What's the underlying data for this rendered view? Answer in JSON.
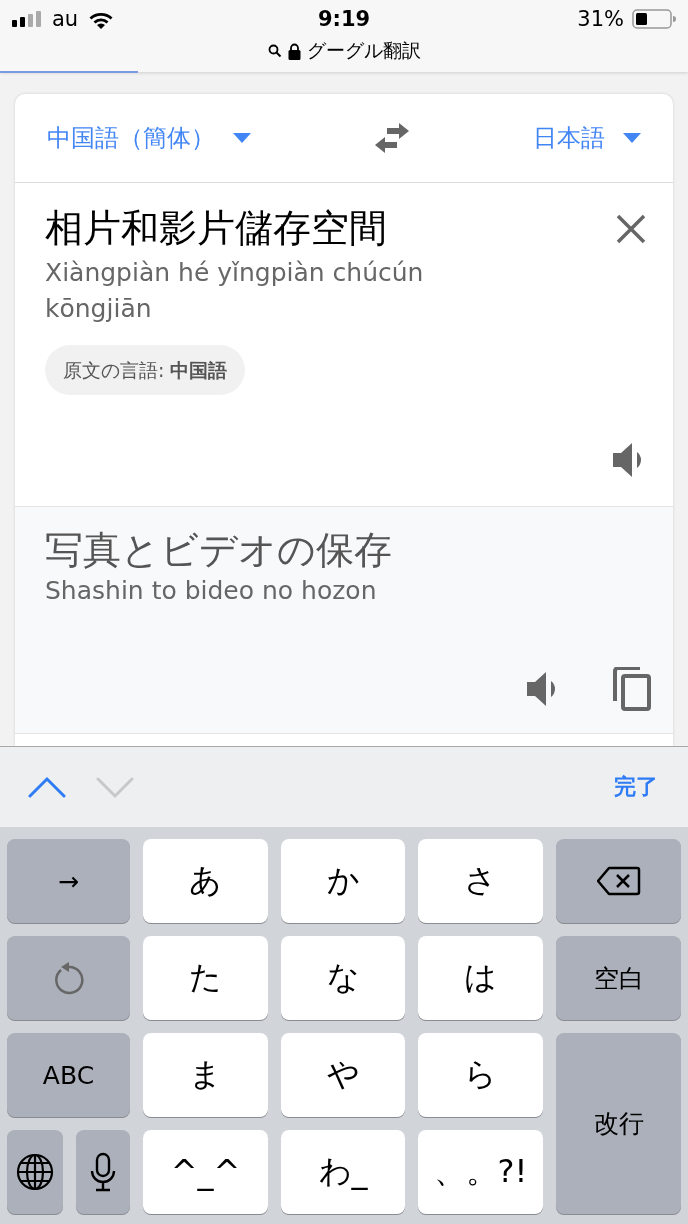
{
  "status_bar": {
    "carrier": "au",
    "time": "9:19",
    "battery": "31%",
    "url": "グーグル翻訳"
  },
  "page_load": {
    "level": 0.2
  },
  "languages": {
    "source": "中国語（簡体）",
    "target": "日本語"
  },
  "source": {
    "text": "相片和影片儲存空間",
    "romanization": "Xiàngpiàn hé yǐngpiàn chúcún kōngjiān",
    "detected": "原文の言語: **中国語**"
  },
  "translation": {
    "text": "写真とビデオの保存",
    "romanization": "Shashin to bideo no hozon"
  },
  "keyboard_toolbar": {
    "nav_buttons": [
      {
        "kind": "up",
        "disabled": false
      },
      {
        "kind": "down",
        "disabled": true
      }
    ],
    "done": "完了"
  },
  "keyboard_rows": [
    [
      {
        "kind": "func",
        "label": "→"
      },
      {
        "kind": "char",
        "label": "あ"
      },
      {
        "kind": "char",
        "label": "か"
      },
      {
        "kind": "char",
        "label": "さ"
      },
      {
        "kind": "delete"
      }
    ],
    [
      {
        "kind": "undo"
      },
      {
        "kind": "char",
        "label": "た"
      },
      {
        "kind": "char",
        "label": "な"
      },
      {
        "kind": "char",
        "label": "は"
      },
      {
        "kind": "func",
        "label": "空白"
      }
    ],
    [
      {
        "kind": "func",
        "label": "ABC"
      },
      {
        "kind": "char",
        "label": "ま"
      },
      {
        "kind": "char",
        "label": "や"
      },
      {
        "kind": "char",
        "label": "ら"
      },
      {
        "kind": "return",
        "label": "改行"
      }
    ],
    [
      {
        "kind": "globe"
      },
      {
        "kind": "mic"
      },
      {
        "kind": "char",
        "label": "^_^"
      },
      {
        "kind": "char",
        "label": "わ_"
      },
      {
        "kind": "char",
        "label": "、。?!"
      }
    ]
  ]
}
